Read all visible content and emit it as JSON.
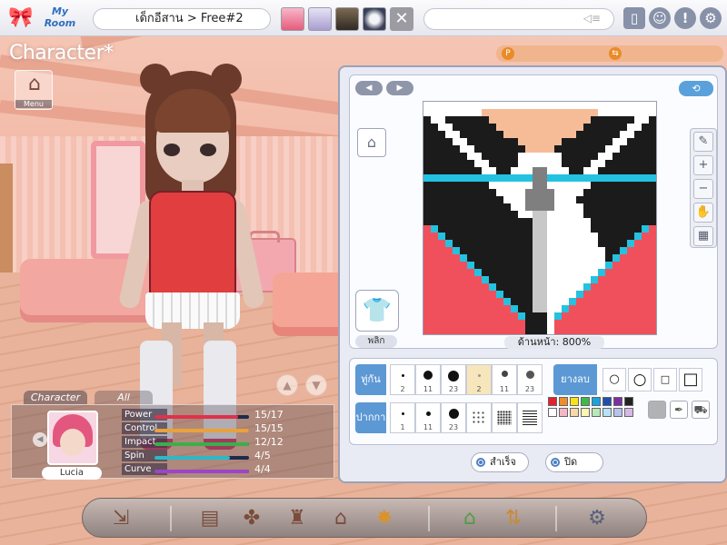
{
  "topbar": {
    "logo_text": "My Room",
    "location": "เด็กอีสาน > Free#2",
    "avatars": [
      "avatar-pink",
      "avatar-lavender",
      "avatar-dark",
      "avatar-orb"
    ],
    "close_glyph": "✕",
    "chat_placeholder": "",
    "icons": [
      "mailbox-icon",
      "friends-icon",
      "alert-icon",
      "settings-icon"
    ]
  },
  "left": {
    "title": "Character*",
    "menu_label": "Menu"
  },
  "character_panel": {
    "tabs": [
      "Character",
      "All"
    ],
    "name": "Lucia",
    "stats": [
      {
        "label": "Power",
        "value": "15/17",
        "fraction": 0.88,
        "color": "#e0324a"
      },
      {
        "label": "Control",
        "value": "15/15",
        "fraction": 1.0,
        "color": "#e9a23b"
      },
      {
        "label": "Impact",
        "value": "12/12",
        "fraction": 1.0,
        "color": "#3cae49"
      },
      {
        "label": "Spin",
        "value": "4/5",
        "fraction": 0.8,
        "color": "#2fb7c8"
      },
      {
        "label": "Curve",
        "value": "4/4",
        "fraction": 1.0,
        "color": "#9b45c9"
      }
    ]
  },
  "editor": {
    "flip_label": "พลิก",
    "zoom_label": "ด้านหน้า: 800%",
    "brush_label": "ทู่กัน",
    "pen_label": "ปากกา",
    "eraser_label": "ยางลบ",
    "brush_sizes": [
      "2",
      "11",
      "23",
      "2",
      "11",
      "23"
    ],
    "pen_sizes": [
      "1",
      "11",
      "23",
      "",
      "",
      ""
    ],
    "palette": [
      "#e5202a",
      "#f28c28",
      "#f7e21b",
      "#3dba4a",
      "#1ca3dd",
      "#1f4fb0",
      "#7b2fa2",
      "#222222",
      "#ffffff",
      "#f7b7c2",
      "#f9d9a8",
      "#fff5b5",
      "#b9e8b7",
      "#b7e1f5",
      "#b6c3ec",
      "#d6b8e6"
    ],
    "ok_label": "สำเร็จ",
    "close_label": "ปิด"
  },
  "pixel_art": {
    "cols": 32,
    "rows": 32,
    "colors": {
      "w": "#ffffff",
      "k": "#1b1b1b",
      "p": "#f0505c",
      "t": "#f6bc98",
      "c": "#23c2e0",
      "g": "#7f7f7f",
      "l": "#c8c8c8"
    }
  },
  "dock": {
    "icons": [
      "exit-icon",
      "map-icon",
      "shop-icon",
      "wardrobe-icon",
      "room-icon",
      "star-icon",
      "house-icon",
      "exchange-icon",
      "settings-icon"
    ]
  }
}
